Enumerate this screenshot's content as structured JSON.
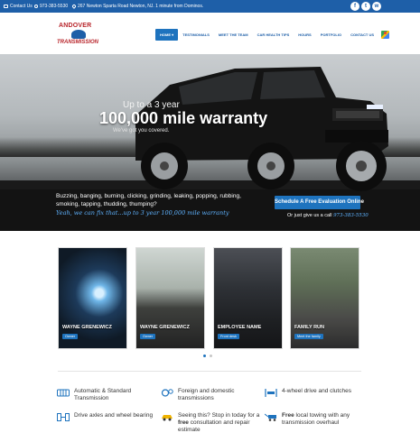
{
  "topbar": {
    "contact_label": "Contact Us",
    "phone": "973-383-5530",
    "address": "267 Newton Sparta Road Newton, NJ. 1 minute from Dominos.",
    "social": [
      "f",
      "t",
      "w"
    ]
  },
  "header": {
    "logo_top": "ANDOVER",
    "logo_bottom": "TRANSMISSION",
    "nav": [
      "HOME ▾",
      "TESTIMONIALS",
      "MEET THE TEAM",
      "CAR HEALTH TIPS",
      "HOURS",
      "PORTFOLIO",
      "CONTACT US"
    ],
    "map_icon": "google-maps-icon"
  },
  "hero": {
    "subtitle": "Up to a 3 year",
    "title": "100,000 mile warranty",
    "tagline": "We've got you covered.",
    "noises": "Buzzing, banging, burning, clicking, grinding, leaking, popping, rubbing, smoking, tapping, thudding, thumping?",
    "fix_line": "Yeah, we can fix that...up to 3 year 100,000 mile warranty",
    "cta_label": "Schedule A Free Evaluation Online",
    "call_prefix": "Or just give us a call",
    "call_number": "973-383-5530"
  },
  "team": [
    {
      "name": "WAYNE GRENEWICZ",
      "role": "Owner"
    },
    {
      "name": "WAYNE GRENEWICZ",
      "role": "Owner"
    },
    {
      "name": "EMPLOYEE NAME",
      "role": "Front desk"
    },
    {
      "name": "FAMILY RUN",
      "role": "Meet the family"
    }
  ],
  "services": {
    "s1": "Automatic & Standard Transmission",
    "s2": "Foreign and domestic transmissions",
    "s3": "4-wheel drive and clutches",
    "s4": "Drive axles and wheel bearing",
    "s5_a": "Seeing this? Stop in today for a ",
    "s5_b": "free",
    "s5_c": " consultation and repair estimate",
    "s6_a": "Free",
    "s6_b": " local towing with any transmission overhaul"
  },
  "colors": {
    "brand_blue": "#1e73be",
    "topbar_blue": "#1e5fa8",
    "logo_red": "#b8242a",
    "accent_light_blue": "#5fb3ff"
  }
}
